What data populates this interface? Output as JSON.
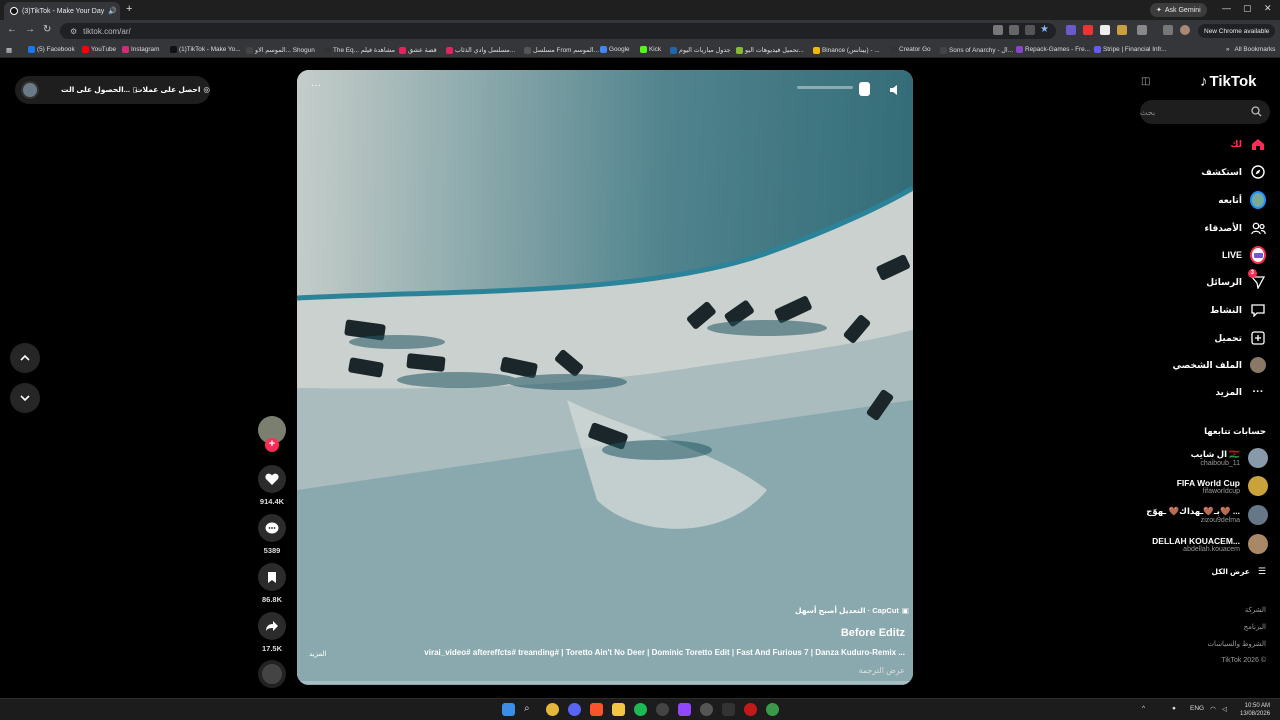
{
  "browser": {
    "tab_title": "(3)TikTok - Make Your Day",
    "new_tab_symbol": "+",
    "url": "tiktok.com/ar/",
    "gemini_label": "Ask Gemini",
    "new_chrome_label": "New Chrome available",
    "all_bookmarks_label": "All Bookmarks",
    "bookmarks": [
      {
        "label": "(5) Facebook",
        "color": "#1877f2"
      },
      {
        "label": "YouTube",
        "color": "#ff0000"
      },
      {
        "label": "Instagram",
        "color": "#d62976"
      },
      {
        "label": "(1)TikTok - Make Yo...",
        "color": "#111111"
      },
      {
        "label": "الموسم الاو... Shogun",
        "color": "#444444"
      },
      {
        "label": "The Eq... مشاهدة فيلم",
        "color": "#333333"
      },
      {
        "label": "قصة عشق",
        "color": "#e0245e"
      },
      {
        "label": "مسلسل وادي الذئاب...",
        "color": "#e0245e"
      },
      {
        "label": "مسلسل From الموسم...",
        "color": "#555555"
      },
      {
        "label": "Google",
        "color": "#4285f4"
      },
      {
        "label": "Kick",
        "color": "#53fc18"
      },
      {
        "label": "جدول مباريات اليوم",
        "color": "#2266aa"
      },
      {
        "label": "تحميل فيديوهات اليو...",
        "color": "#88bb33"
      },
      {
        "label": "Binance (بينانس) - ...",
        "color": "#f0b90b"
      },
      {
        "label": "Creator Go",
        "color": "#333333"
      },
      {
        "label": "Sons of Anarchy - ال...",
        "color": "#444444"
      },
      {
        "label": "Repack-Games - Fre...",
        "color": "#8844cc"
      },
      {
        "label": "Stripe | Financial Infr...",
        "color": "#635bff"
      }
    ]
  },
  "topbar": {
    "get_coins": "احصل على عملات",
    "get_app": "الحصول على الت..."
  },
  "video": {
    "capcut_label": "CapCut · التعديل أصبح أسهل",
    "author": "Before Editz",
    "description": "virai_video# aftereffcts# treanding# | Toretto Ain't No Deer | Dominic Toretto Edit | Fast And Furious 7 | Danza Kuduro-Remix ...",
    "more": "المزيد",
    "translate": "عرض الترجمة",
    "menu_dots": "···"
  },
  "actions": {
    "likes": "914.4K",
    "comments": "5389",
    "saves": "86.8K",
    "shares": "17.5K"
  },
  "sidebar": {
    "logo": "TikTok",
    "search_placeholder": "بحث",
    "nav": [
      {
        "label": "لك",
        "icon": "home-icon",
        "active": true
      },
      {
        "label": "استكشف",
        "icon": "compass-icon"
      },
      {
        "label": "أتابعه",
        "icon": "following-avatar-icon"
      },
      {
        "label": "الأصدقاء",
        "icon": "friends-icon"
      },
      {
        "label": "LIVE",
        "icon": "live-icon"
      },
      {
        "label": "الرسائل",
        "icon": "messages-icon",
        "badge": "3"
      },
      {
        "label": "النشاط",
        "icon": "activity-icon"
      },
      {
        "label": "تحميل",
        "icon": "upload-icon"
      },
      {
        "label": "الملف الشخصي",
        "icon": "profile-icon"
      },
      {
        "label": "المزيد",
        "icon": "more-icon"
      }
    ],
    "following_title": "حسابات تتابعها",
    "following": [
      {
        "name": "ال شايب 🇱🇾",
        "handle": "chaiboub_11",
        "color": "#8899aa"
      },
      {
        "name": "FIFA World Cup",
        "handle": "fifaworldcup",
        "color": "#c9a23c"
      },
      {
        "name": "بـ🤎ـهداك🤎 ـهوّج🤎 ...",
        "handle": "zizou9delma",
        "color": "#667788"
      },
      {
        "name": "DELLAH KOUACEM...",
        "handle": "abdellah.kouacem",
        "color": "#aa8866"
      }
    ],
    "see_all": "عرض الكل",
    "footer": [
      "الشركة",
      "البرنامج",
      "الشروط والسياسات",
      "© TikTok 2026"
    ]
  },
  "taskbar": {
    "lang": "ENG",
    "time": "10:50 AM",
    "date": "13/08/2026"
  }
}
